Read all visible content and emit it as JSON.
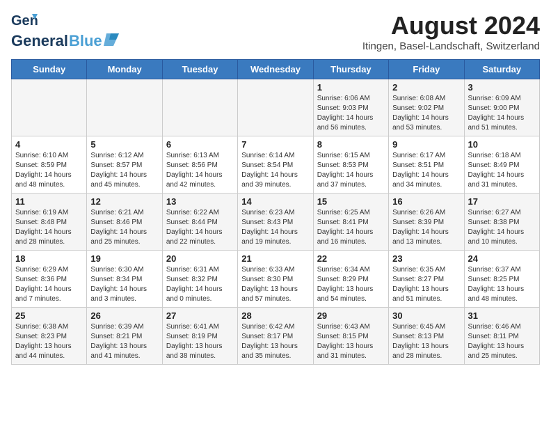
{
  "header": {
    "logo_general": "General",
    "logo_blue": "Blue",
    "main_title": "August 2024",
    "subtitle": "Itingen, Basel-Landschaft, Switzerland"
  },
  "days_of_week": [
    "Sunday",
    "Monday",
    "Tuesday",
    "Wednesday",
    "Thursday",
    "Friday",
    "Saturday"
  ],
  "weeks": [
    [
      {
        "day": "",
        "info": ""
      },
      {
        "day": "",
        "info": ""
      },
      {
        "day": "",
        "info": ""
      },
      {
        "day": "",
        "info": ""
      },
      {
        "day": "1",
        "info": "Sunrise: 6:06 AM\nSunset: 9:03 PM\nDaylight: 14 hours and 56 minutes."
      },
      {
        "day": "2",
        "info": "Sunrise: 6:08 AM\nSunset: 9:02 PM\nDaylight: 14 hours and 53 minutes."
      },
      {
        "day": "3",
        "info": "Sunrise: 6:09 AM\nSunset: 9:00 PM\nDaylight: 14 hours and 51 minutes."
      }
    ],
    [
      {
        "day": "4",
        "info": "Sunrise: 6:10 AM\nSunset: 8:59 PM\nDaylight: 14 hours and 48 minutes."
      },
      {
        "day": "5",
        "info": "Sunrise: 6:12 AM\nSunset: 8:57 PM\nDaylight: 14 hours and 45 minutes."
      },
      {
        "day": "6",
        "info": "Sunrise: 6:13 AM\nSunset: 8:56 PM\nDaylight: 14 hours and 42 minutes."
      },
      {
        "day": "7",
        "info": "Sunrise: 6:14 AM\nSunset: 8:54 PM\nDaylight: 14 hours and 39 minutes."
      },
      {
        "day": "8",
        "info": "Sunrise: 6:15 AM\nSunset: 8:53 PM\nDaylight: 14 hours and 37 minutes."
      },
      {
        "day": "9",
        "info": "Sunrise: 6:17 AM\nSunset: 8:51 PM\nDaylight: 14 hours and 34 minutes."
      },
      {
        "day": "10",
        "info": "Sunrise: 6:18 AM\nSunset: 8:49 PM\nDaylight: 14 hours and 31 minutes."
      }
    ],
    [
      {
        "day": "11",
        "info": "Sunrise: 6:19 AM\nSunset: 8:48 PM\nDaylight: 14 hours and 28 minutes."
      },
      {
        "day": "12",
        "info": "Sunrise: 6:21 AM\nSunset: 8:46 PM\nDaylight: 14 hours and 25 minutes."
      },
      {
        "day": "13",
        "info": "Sunrise: 6:22 AM\nSunset: 8:44 PM\nDaylight: 14 hours and 22 minutes."
      },
      {
        "day": "14",
        "info": "Sunrise: 6:23 AM\nSunset: 8:43 PM\nDaylight: 14 hours and 19 minutes."
      },
      {
        "day": "15",
        "info": "Sunrise: 6:25 AM\nSunset: 8:41 PM\nDaylight: 14 hours and 16 minutes."
      },
      {
        "day": "16",
        "info": "Sunrise: 6:26 AM\nSunset: 8:39 PM\nDaylight: 14 hours and 13 minutes."
      },
      {
        "day": "17",
        "info": "Sunrise: 6:27 AM\nSunset: 8:38 PM\nDaylight: 14 hours and 10 minutes."
      }
    ],
    [
      {
        "day": "18",
        "info": "Sunrise: 6:29 AM\nSunset: 8:36 PM\nDaylight: 14 hours and 7 minutes."
      },
      {
        "day": "19",
        "info": "Sunrise: 6:30 AM\nSunset: 8:34 PM\nDaylight: 14 hours and 3 minutes."
      },
      {
        "day": "20",
        "info": "Sunrise: 6:31 AM\nSunset: 8:32 PM\nDaylight: 14 hours and 0 minutes."
      },
      {
        "day": "21",
        "info": "Sunrise: 6:33 AM\nSunset: 8:30 PM\nDaylight: 13 hours and 57 minutes."
      },
      {
        "day": "22",
        "info": "Sunrise: 6:34 AM\nSunset: 8:29 PM\nDaylight: 13 hours and 54 minutes."
      },
      {
        "day": "23",
        "info": "Sunrise: 6:35 AM\nSunset: 8:27 PM\nDaylight: 13 hours and 51 minutes."
      },
      {
        "day": "24",
        "info": "Sunrise: 6:37 AM\nSunset: 8:25 PM\nDaylight: 13 hours and 48 minutes."
      }
    ],
    [
      {
        "day": "25",
        "info": "Sunrise: 6:38 AM\nSunset: 8:23 PM\nDaylight: 13 hours and 44 minutes."
      },
      {
        "day": "26",
        "info": "Sunrise: 6:39 AM\nSunset: 8:21 PM\nDaylight: 13 hours and 41 minutes."
      },
      {
        "day": "27",
        "info": "Sunrise: 6:41 AM\nSunset: 8:19 PM\nDaylight: 13 hours and 38 minutes."
      },
      {
        "day": "28",
        "info": "Sunrise: 6:42 AM\nSunset: 8:17 PM\nDaylight: 13 hours and 35 minutes."
      },
      {
        "day": "29",
        "info": "Sunrise: 6:43 AM\nSunset: 8:15 PM\nDaylight: 13 hours and 31 minutes."
      },
      {
        "day": "30",
        "info": "Sunrise: 6:45 AM\nSunset: 8:13 PM\nDaylight: 13 hours and 28 minutes."
      },
      {
        "day": "31",
        "info": "Sunrise: 6:46 AM\nSunset: 8:11 PM\nDaylight: 13 hours and 25 minutes."
      }
    ]
  ]
}
